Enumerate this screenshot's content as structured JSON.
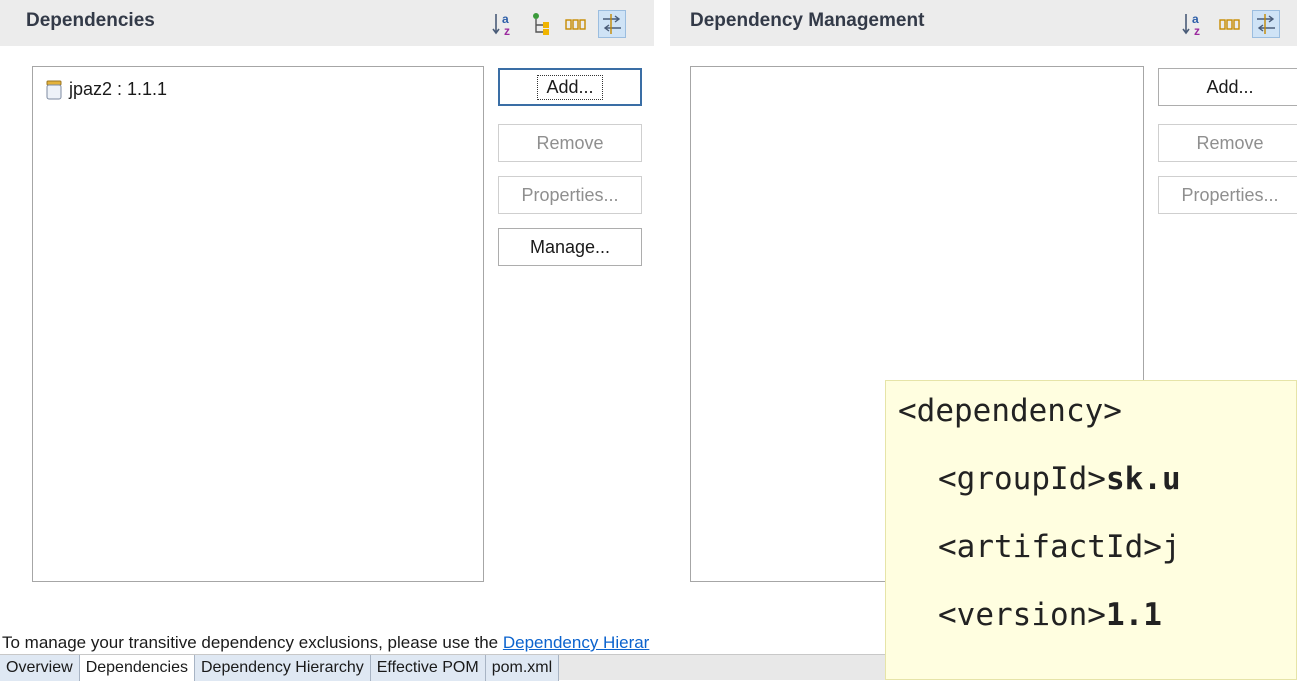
{
  "dependencies": {
    "title": "Dependencies",
    "items": [
      {
        "label": "jpaz2 : 1.1.1"
      }
    ],
    "buttons": {
      "add": "Add...",
      "remove": "Remove",
      "properties": "Properties...",
      "manage": "Manage..."
    }
  },
  "management": {
    "title": "Dependency Management",
    "buttons": {
      "add": "Add...",
      "remove": "Remove",
      "properties": "Properties..."
    }
  },
  "toolbar_icons": [
    "sort-alphabetically-icon",
    "show-group-id-icon",
    "show-columns-icon",
    "filter-icon"
  ],
  "hint": {
    "text": "To manage your transitive dependency exclusions, please use the ",
    "link": "Dependency Hierar"
  },
  "tabs": [
    "Overview",
    "Dependencies",
    "Dependency Hierarchy",
    "Effective POM",
    "pom.xml"
  ],
  "active_tab": "Dependencies",
  "code": {
    "line1": "<dependency>",
    "line2_tag": "<groupId>",
    "line2_value": "sk.u",
    "line3_tag": "<artifactId>",
    "line3_value": "j",
    "line4_tag": "<version>",
    "line4_value": "1.1"
  },
  "colors": {
    "header_bg": "#ececec",
    "link": "#0b63ce",
    "code_bg": "#fffee0",
    "tab_bg": "#dfe8f3"
  }
}
